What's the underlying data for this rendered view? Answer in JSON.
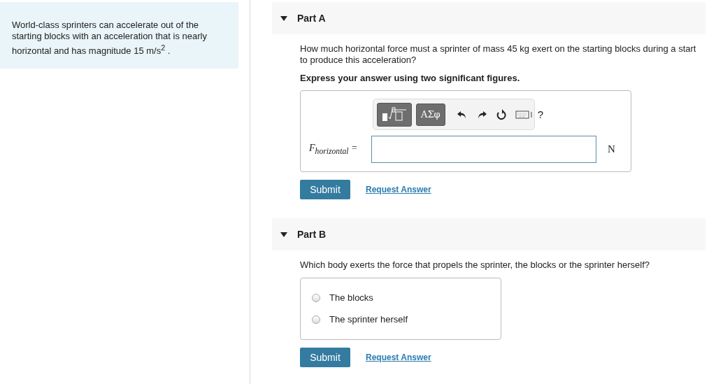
{
  "intro": "World-class sprinters can accelerate out of the starting blocks with an acceleration that is nearly horizontal and has magnitude 15 m/s$^{2}$ .",
  "parts": [
    {
      "kind": "numeric",
      "title": "Part A",
      "expanded": true,
      "question": "How much horizontal force must a sprinter of mass 45 kg exert on the starting blocks during a start to produce this acceleration?",
      "instruction": "Express your answer using two significant figures.",
      "toolbar": {
        "symbols": "ΑΣφ",
        "help": "?"
      },
      "label": "F$_{horizontal}$ =",
      "unit": "N",
      "submit": "Submit",
      "link": "Request Answer"
    },
    {
      "kind": "choice",
      "title": "Part B",
      "expanded": true,
      "question": "Which body exerts the force that propels the sprinter, the blocks or the sprinter herself?",
      "options": [
        {
          "label": "The blocks",
          "selected": false
        },
        {
          "label": "The sprinter herself",
          "selected": false
        }
      ],
      "submit": "Submit",
      "link": "Request Answer"
    }
  ]
}
